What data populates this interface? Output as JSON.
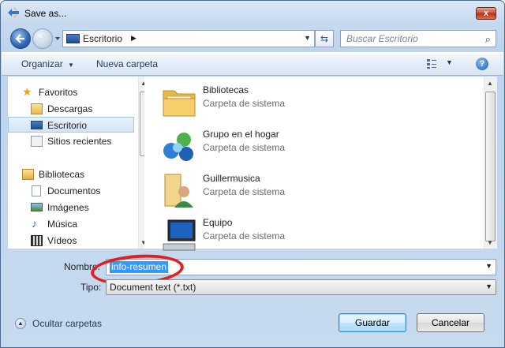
{
  "window": {
    "title": "Save as...",
    "close_label": "x"
  },
  "address_bar": {
    "location": "Escritorio",
    "search_placeholder": "Buscar Escritorio"
  },
  "toolbar": {
    "organize_label": "Organizar",
    "new_folder_label": "Nueva carpeta",
    "help_label": "?"
  },
  "sidebar": {
    "favorites_label": "Favoritos",
    "favorites": [
      "Descargas",
      "Escritorio",
      "Sitios recientes"
    ],
    "libraries_label": "Bibliotecas",
    "libraries": [
      "Documentos",
      "Imágenes",
      "Música",
      "Vídeos"
    ],
    "selected": "Escritorio"
  },
  "content": {
    "items": [
      {
        "name": "Bibliotecas",
        "type": "Carpeta de sistema"
      },
      {
        "name": "Grupo en el hogar",
        "type": "Carpeta de sistema"
      },
      {
        "name": "Guillermusica",
        "type": "Carpeta de sistema"
      },
      {
        "name": "Equipo",
        "type": "Carpeta de sistema"
      }
    ]
  },
  "form": {
    "filename_label": "Nombre:",
    "filename_value": "info-resumen",
    "type_label": "Tipo:",
    "type_value": "Document text (*.txt)"
  },
  "footer": {
    "hide_folders_label": "Ocultar carpetas",
    "save_label": "Guardar",
    "cancel_label": "Cancelar"
  },
  "colors": {
    "highlight": "#e21f1f",
    "selection": "#3399ff"
  }
}
